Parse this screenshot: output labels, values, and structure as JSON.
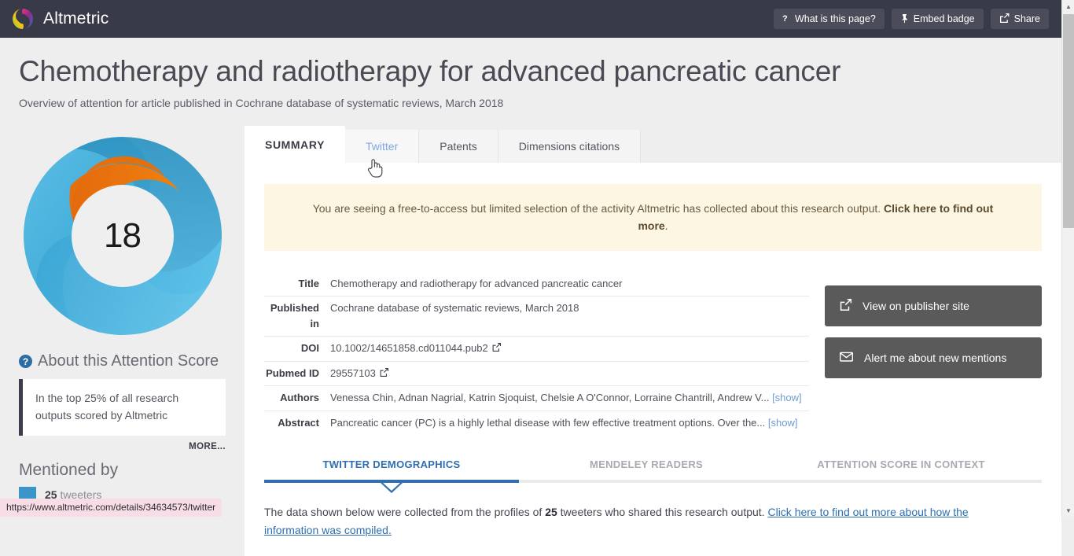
{
  "topbar": {
    "brand": "Altmetric",
    "buttons": [
      {
        "icon": "question-mark-icon",
        "glyph": "❓",
        "label": "What is this page?"
      },
      {
        "icon": "pin-icon",
        "glyph": "📌",
        "label": "Embed badge"
      },
      {
        "icon": "share-icon",
        "glyph": "↪",
        "label": "Share"
      }
    ]
  },
  "header": {
    "title": "Chemotherapy and radiotherapy for advanced pancreatic cancer",
    "subtitle": "Overview of attention for article published in Cochrane database of systematic reviews, March 2018"
  },
  "sidebar": {
    "badge_score": "18",
    "about_heading": "About this Attention Score",
    "about_help_glyph": "?",
    "quote": "In the top 25% of all research outputs scored by Altmetric",
    "more_label": "MORE...",
    "mentioned_heading": "Mentioned by",
    "mentions": [
      {
        "count": "25",
        "label": "tweeters",
        "color": "#3b95c8"
      }
    ]
  },
  "tabs": [
    {
      "label": "SUMMARY",
      "state": "active"
    },
    {
      "label": "Twitter",
      "state": "hover"
    },
    {
      "label": "Patents",
      "state": "normal"
    },
    {
      "label": "Dimensions citations",
      "state": "normal"
    }
  ],
  "notice": {
    "text": "You are seeing a free-to-access but limited selection of the activity Altmetric has collected about this research output.",
    "link": "Click here to find out more",
    "tail": "."
  },
  "metadata": [
    {
      "key": "Title",
      "value": "Chemotherapy and radiotherapy for advanced pancreatic cancer",
      "ext": false,
      "show": false
    },
    {
      "key": "Published in",
      "value": "Cochrane database of systematic reviews, March 2018",
      "ext": false,
      "show": false
    },
    {
      "key": "DOI",
      "value": "10.1002/14651858.cd011044.pub2",
      "ext": true,
      "show": false
    },
    {
      "key": "Pubmed ID",
      "value": "29557103",
      "ext": true,
      "show": false
    },
    {
      "key": "Authors",
      "value": "Venessa Chin, Adnan Nagrial, Katrin Sjoquist, Chelsie A O'Connor, Lorraine Chantrill, Andrew V...",
      "ext": false,
      "show": true
    },
    {
      "key": "Abstract",
      "value": "Pancreatic cancer (PC) is a highly lethal disease with few effective treatment options. Over the...",
      "ext": false,
      "show": true
    }
  ],
  "show_label": "[show]",
  "side_actions": [
    {
      "icon": "external-link-icon",
      "glyph": "↗",
      "label": "View on publisher site"
    },
    {
      "icon": "envelope-icon",
      "glyph": "✉",
      "label": "Alert me about new mentions"
    }
  ],
  "subtabs": [
    {
      "label": "TWITTER DEMOGRAPHICS",
      "state": "active"
    },
    {
      "label": "MENDELEY READERS",
      "state": "normal"
    },
    {
      "label": "ATTENTION SCORE IN CONTEXT",
      "state": "normal"
    }
  ],
  "collected": {
    "pre": "The data shown below were collected from the profiles of",
    "count": "25",
    "mid": "tweeters who shared this research output.",
    "link": "Click here to find out more about how the information was compiled."
  },
  "statusbar": {
    "url": "https://www.altmetric.com/details/34634573/twitter"
  },
  "colors": {
    "header_bg": "#383a47",
    "page_bg": "#eeeeee",
    "accent_blue": "#2f6fb0",
    "notice_bg": "#fcf6e3",
    "badge_orange": "#e2700f",
    "badge_blue": "#3ea8d8"
  }
}
